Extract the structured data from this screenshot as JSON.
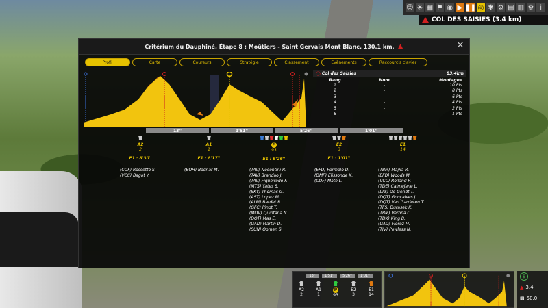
{
  "toolbar": {
    "icons": [
      "rider-icon",
      "weather-icon",
      "map-icon",
      "flag-icon",
      "camera-icon",
      "play-icon",
      "pause-icon",
      "eye-icon",
      "fan-icon",
      "bike-icon",
      "stats-icon",
      "chart-icon",
      "settings-icon",
      "help-icon"
    ],
    "climb_label": "COL DES SAISIES (3.4 km)"
  },
  "dialog": {
    "title": "Critérium du Dauphiné, Étape 8 : Moûtiers - Saint Gervais Mont Blanc. 130.1 km.",
    "tabs": [
      "Profil",
      "Carte",
      "Coureurs",
      "Stratégie",
      "Classement",
      "Evènements",
      "Raccourcis clavier"
    ],
    "active_tab": "Profil"
  },
  "ranking": {
    "climb": "Col des Saisies",
    "distance": "83.4km",
    "headers": [
      "Rang",
      "Nom",
      "Montagne"
    ],
    "rows": [
      {
        "rank": "1",
        "name": "-",
        "pts": "10 Pts"
      },
      {
        "rank": "2",
        "name": "-",
        "pts": "8 Pts"
      },
      {
        "rank": "3",
        "name": "-",
        "pts": "6 Pts"
      },
      {
        "rank": "4",
        "name": "-",
        "pts": "4 Pts"
      },
      {
        "rank": "5",
        "name": "-",
        "pts": "2 Pts"
      },
      {
        "rank": "6",
        "name": "-",
        "pts": "1 Pts"
      }
    ]
  },
  "gaps": [
    "13''",
    "1'51''",
    "5'26''",
    "1'01''"
  ],
  "groups": [
    {
      "code": "A2",
      "count": "2",
      "time": "E1 : 8'30''",
      "jerseys": [
        "#cccccc"
      ],
      "riders": [
        "(COF) Rossetto S.",
        "(VCC) Bagot Y."
      ]
    },
    {
      "code": "A1",
      "count": "1",
      "time": "E1 : 8'17''",
      "jerseys": [
        "#cccccc"
      ],
      "riders": [
        "(BOH) Bodnar M."
      ]
    },
    {
      "code": "P",
      "count": "93",
      "time": "E1 : 6'26''",
      "jerseys": [
        "#3a7bd5",
        "#cccccc",
        "#e03030",
        "#ffffff",
        "#2ecc40",
        "#e6c200"
      ],
      "riders": [
        "(TAV) Nocentini R.",
        "(TAV) Brandao J.",
        "(TAV) Figueiredo F.",
        "(MTS) Yates S.",
        "(SKY) Thomas G.",
        "(AST) Lopez M.",
        "(ALM) Bardet R.",
        "(GFC) Pinot T.",
        "(MOV) Quintana N.",
        "(DQT) Mas E.",
        "(UAD) Martin D.",
        "(SUN) Oomen S."
      ]
    },
    {
      "code": "E2",
      "count": "3",
      "time": "E1 : 1'01''",
      "jerseys": [
        "#cccccc",
        "#cccccc",
        "#e07a10"
      ],
      "riders": [
        "(EFD) Formolo D.",
        "(DMP) Elissonde K.",
        "(COF) Mate L."
      ]
    },
    {
      "code": "E1",
      "count": "14",
      "time": "",
      "jerseys": [
        "#cccccc",
        "#cccccc",
        "#cccccc",
        "#cccccc",
        "#cccccc",
        "#e07a10"
      ],
      "riders": [
        "(TBM) Majka R.",
        "(EFD) Woods M.",
        "(VCC) Rolland P.",
        "(TDE) Calmejane L.",
        "(LTS) De Gendt T.",
        "(DQT) Gonçalves J.",
        "(DQT) Van Garderen T.",
        "(TFS) Durasek K.",
        "(TBM) Verona C.",
        "(TDK) King B.",
        "(UAD) Florez M.",
        "(TJV) Powless N."
      ]
    }
  ],
  "hud": {
    "gaps": [
      "13''",
      "1'51''",
      "5'26''",
      "1'01''"
    ],
    "groups": [
      {
        "code": "A2",
        "count": "2"
      },
      {
        "code": "A1",
        "count": "1"
      },
      {
        "code": "P",
        "count": "93"
      },
      {
        "code": "E2",
        "count": "3"
      },
      {
        "code": "E1",
        "count": "14"
      }
    ],
    "remaining_km": "3.4",
    "speed": "50.0"
  },
  "colors": {
    "accent": "#e6c200",
    "orange": "#e07a10",
    "profile_yellow": "#f2c40e",
    "sprint_red": "#d02020"
  }
}
